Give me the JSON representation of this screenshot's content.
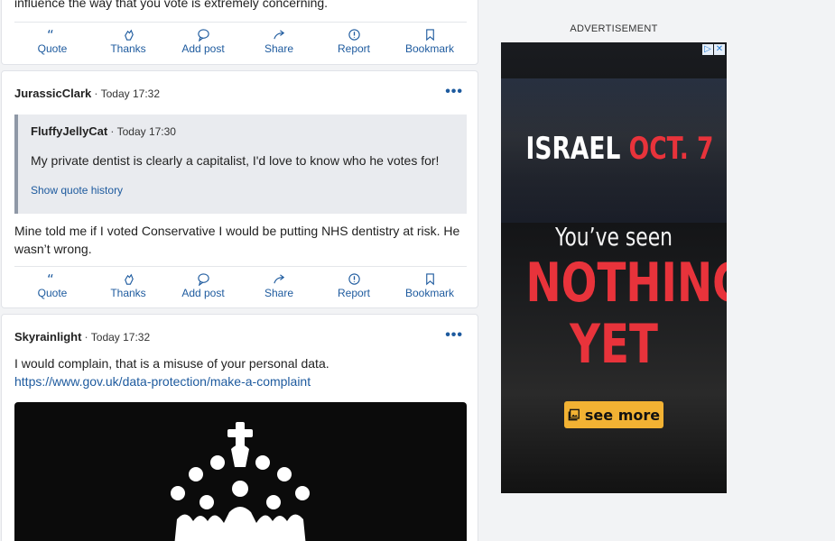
{
  "posts": {
    "top": {
      "text": "influence the way that you vote is extremely concerning."
    },
    "mid": {
      "author": "JurassicClark",
      "time": "Today 17:32",
      "quote": {
        "author": "FluffyJellyCat",
        "time": "Today 17:30",
        "text": "My private dentist is clearly a capitalist, I'd love to know who he votes for!",
        "history_label": "Show quote history"
      },
      "body_line1": "Mine told me if I voted Conservative I would be putting NHS dentistry at risk. He",
      "body_line2": "wasn’t wrong."
    },
    "bot": {
      "author": "Skyrainlight",
      "time": "Today 17:32",
      "body_line1": "I would complain, that is a misuse of your personal data.",
      "link": "https://www.gov.uk/data-protection/make-a-complaint"
    }
  },
  "actions": {
    "quote": "Quote",
    "thanks": "Thanks",
    "add_post": "Add post",
    "share": "Share",
    "report": "Report",
    "bookmark": "Bookmark"
  },
  "more_label": "•••",
  "separator": "·",
  "ad": {
    "label": "ADVERTISEMENT",
    "headline_white": "ISRAEL ",
    "headline_red": "OCT. 7",
    "sub": "You’ve seen",
    "big1": "NOTHING",
    "big2": "YET",
    "cta": "see more",
    "badge_play": "▷",
    "badge_close": "✕"
  },
  "colors": {
    "link": "#1d5a9e",
    "ad_red": "#e8333b",
    "ad_cta": "#f2b233"
  }
}
